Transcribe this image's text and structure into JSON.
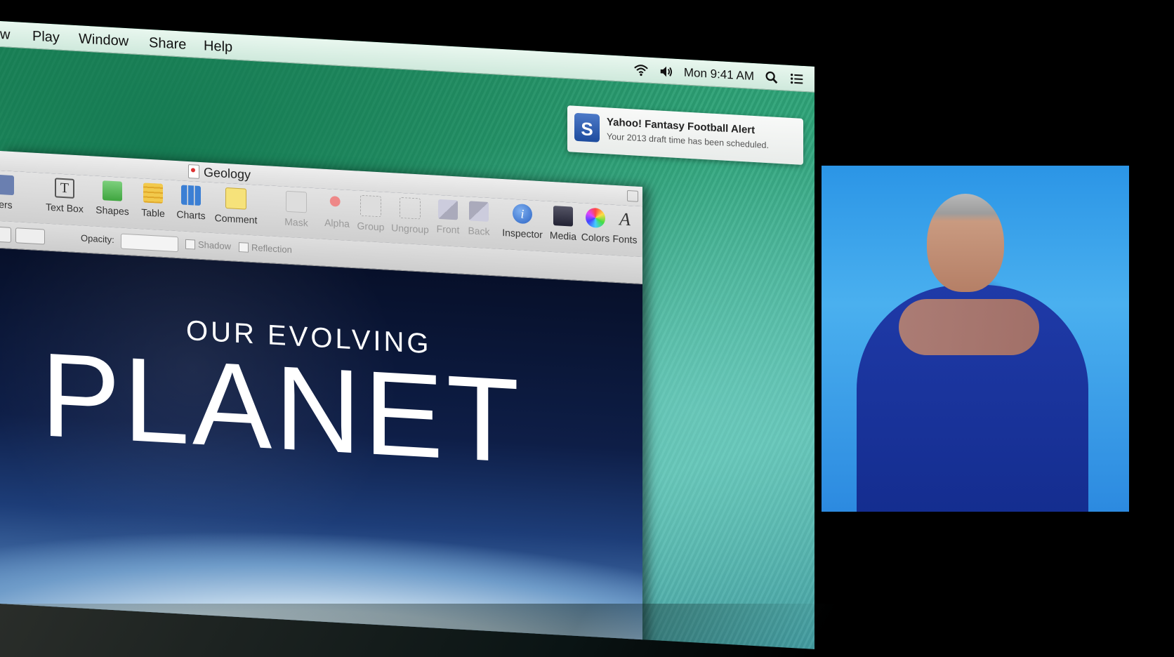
{
  "menubar": {
    "items": [
      "w",
      "Play",
      "Window",
      "Share",
      "Help"
    ],
    "clock": "Mon 9:41 AM",
    "icons": [
      "wifi-icon",
      "volume-icon",
      "spotlight-search-icon",
      "notification-center-icon"
    ]
  },
  "notification": {
    "icon_label": "S",
    "title": "Yahoo! Fantasy Football Alert",
    "body": "Your 2013 draft time has been scheduled."
  },
  "window": {
    "title": "Geology",
    "toolbar": [
      {
        "label": "ters",
        "icon": "characters-icon"
      },
      {
        "label": "Text Box",
        "icon": "text-box-icon"
      },
      {
        "label": "Shapes",
        "icon": "shapes-icon"
      },
      {
        "label": "Table",
        "icon": "table-icon"
      },
      {
        "label": "Charts",
        "icon": "charts-icon"
      },
      {
        "label": "Comment",
        "icon": "comment-icon"
      },
      {
        "label": "Mask",
        "icon": "mask-icon"
      },
      {
        "label": "Alpha",
        "icon": "alpha-icon"
      },
      {
        "label": "Group",
        "icon": "group-icon"
      },
      {
        "label": "Ungroup",
        "icon": "ungroup-icon"
      },
      {
        "label": "Front",
        "icon": "front-icon"
      },
      {
        "label": "Back",
        "icon": "back-icon"
      },
      {
        "label": "Inspector",
        "icon": "inspector-icon"
      },
      {
        "label": "Media",
        "icon": "media-icon"
      },
      {
        "label": "Colors",
        "icon": "colors-icon"
      },
      {
        "label": "Fonts",
        "icon": "fonts-icon"
      }
    ],
    "format_bar": {
      "opacity_label": "Opacity:",
      "shadow_label": "Shadow",
      "reflection_label": "Reflection"
    }
  },
  "slide": {
    "subtitle": "OUR EVOLVING",
    "title": "PLANET"
  },
  "colors": {
    "wallpaper": "#2fa57a",
    "notification_icon": "#1e4c9e",
    "speaker_backdrop": "#2b95e6"
  }
}
